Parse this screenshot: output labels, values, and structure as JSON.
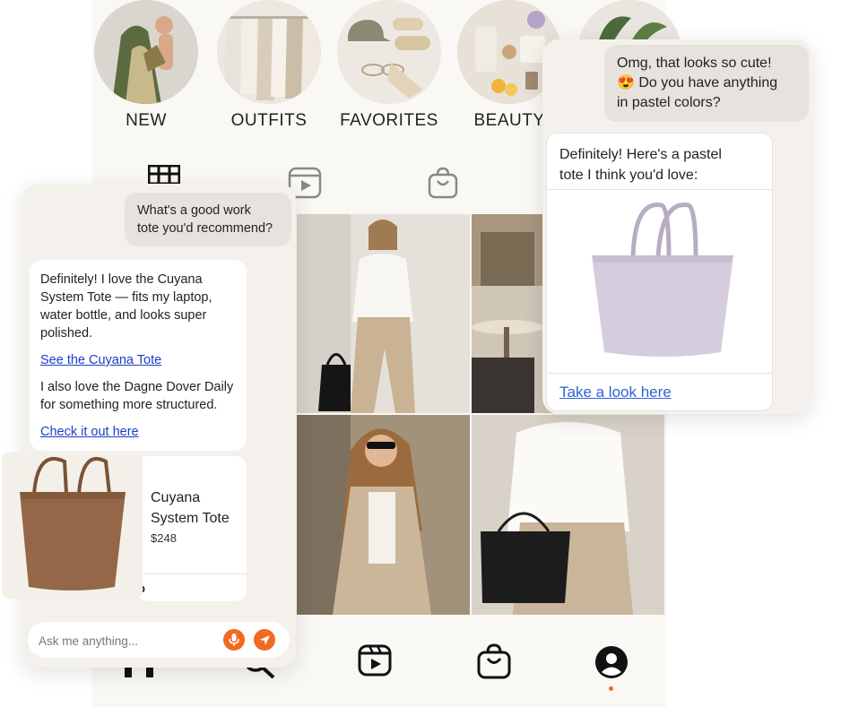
{
  "stories": [
    {
      "label": "NEW",
      "icon": "new-story-photo"
    },
    {
      "label": "OUTFITS",
      "icon": "outfits-story-photo"
    },
    {
      "label": "FAVORITES",
      "icon": "favorites-story-photo"
    },
    {
      "label": "BEAUTY",
      "icon": "beauty-story-photo"
    },
    {
      "label": "",
      "icon": "plant-story-photo"
    }
  ],
  "tabs": [
    {
      "name": "grid",
      "icon": "grid-icon"
    },
    {
      "name": "reels",
      "icon": "reels-icon"
    },
    {
      "name": "shop",
      "icon": "shopping-bag-icon"
    }
  ],
  "bottom_nav": [
    {
      "name": "home",
      "icon": "home-icon"
    },
    {
      "name": "search",
      "icon": "search-icon"
    },
    {
      "name": "reels",
      "icon": "reels-icon"
    },
    {
      "name": "shop",
      "icon": "shopping-bag-icon"
    },
    {
      "name": "profile",
      "icon": "profile-icon",
      "active": true
    }
  ],
  "chat_left": {
    "user_message_line1": "What's a good work",
    "user_message_line2": "tote you'd recommend?",
    "bot_intro_line1": "Definitely! I love the Cuyana",
    "bot_intro_line2": "System Tote — fits my laptop,",
    "bot_intro_line3": "water bottle, and looks super",
    "bot_intro_line4": "polished.",
    "link_1": "See the Cuyana Tote",
    "bot_second_line1": "I also love the Dagne Dover Daily",
    "bot_second_line2": "for something more structured.",
    "link_2": "Check it out here",
    "product": {
      "name_line1": "Cuyana",
      "name_line2": "System Tote",
      "price": "$248",
      "footer_partial": "p"
    },
    "input_placeholder": "Ask me anything..."
  },
  "chat_right": {
    "user_message_line1": "Omg, that looks so cute!",
    "user_message_line2": "😍 Do you have anything",
    "user_message_line3": "in pastel colors?",
    "bot_line1": "Definitely! Here's a pastel",
    "bot_line2": "tote I think you'd love:",
    "link": "Take a look here"
  },
  "colors": {
    "accent": "#f26a21",
    "link": "#1a3ec9",
    "panel_bg": "#f4f1ec",
    "app_bg": "#faf8f4"
  }
}
